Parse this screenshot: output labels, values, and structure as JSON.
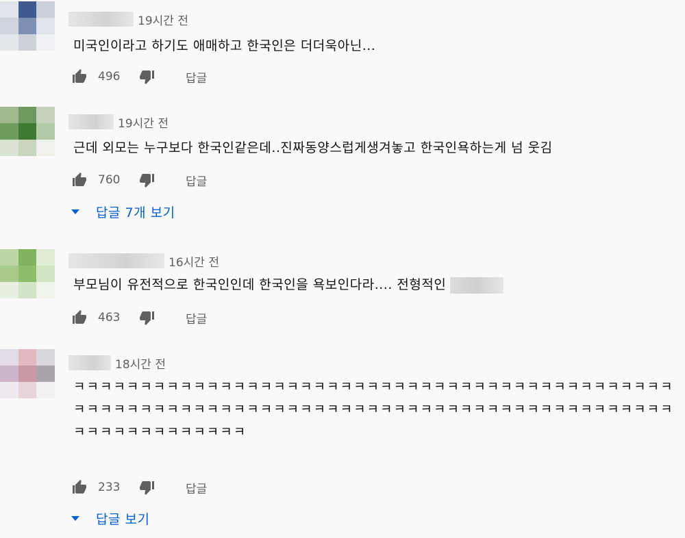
{
  "comments": [
    {
      "time": "19시간 전",
      "text": "미국인이라고 하기도 애매하고 한국인은 더더욱아닌...",
      "likes": "496",
      "reply_label": "답글",
      "avatar_colors": [
        "#dfe3ea",
        "#3f5a8f",
        "#c9d0dc",
        "#cfd5df",
        "#7d8fb2",
        "#dfe3ea",
        "#e4e7ec",
        "#cdd2d9",
        "#eef0f3"
      ]
    },
    {
      "time": "19시간 전",
      "text": "근데 외모는 누구보다 한국인같은데..진짜동양스럽게생겨놓고 한국인욕하는게 넘 웃김",
      "likes": "760",
      "reply_label": "답글",
      "view_replies": "답글 7개 보기",
      "avatar_colors": [
        "#9fb98f",
        "#6f9a5f",
        "#c6d2be",
        "#6e9c5c",
        "#3e7a32",
        "#b4c9a8",
        "#d9e2d3",
        "#c8d6bf",
        "#eef2eb"
      ]
    },
    {
      "time": "16시간 전",
      "text": "부모님이 유전적으로 한국인인데 한국인을 욕보인다라.... 전형적인",
      "likes": "463",
      "reply_label": "답글",
      "avatar_colors": [
        "#bcd6a6",
        "#7fb35e",
        "#dfeed2",
        "#a8cb8c",
        "#8cbf6a",
        "#d3e6c3",
        "#e6efe0",
        "#d4e4c8",
        "#f0f5ec"
      ]
    },
    {
      "time": "18시간 전",
      "text": "ㅋㅋㅋㅋㅋㅋㅋㅋㅋㅋㅋㅋㅋㅋㅋㅋㅋㅋㅋㅋㅋㅋㅋㅋㅋㅋㅋㅋㅋㅋㅋㅋㅋㅋㅋㅋㅋㅋㅋㅋㅋㅋㅋㅋㅋㅋㅋㅋㅋㅋㅋㅋㅋㅋㅋㅋㅋㅋㅋㅋㅋㅋㅋㅋㅋㅋㅋㅋㅋㅋㅋㅋㅋㅋㅋㅋㅋㅋㅋㅋㅋㅋㅋㅋㅋㅋㅋㅋㅋㅋㅋㅋㅋㅋㅋㅋㅋㅋㅋㅋㅋㅋㅋ",
      "likes": "233",
      "reply_label": "답글",
      "view_replies": "답글 보기",
      "avatar_colors": [
        "#e3dbe6",
        "#e2b9c0",
        "#d9d7dc",
        "#cdb5c9",
        "#c99aa4",
        "#a9a3ab",
        "#eeeaf0",
        "#e6d6da",
        "#f2eff3"
      ]
    }
  ],
  "icons": {
    "like": "thumbs-up-icon",
    "dislike": "thumbs-down-icon",
    "expand": "caret-down-icon"
  },
  "colors": {
    "link": "#065fd4",
    "meta": "#606060",
    "icon": "#606060"
  }
}
